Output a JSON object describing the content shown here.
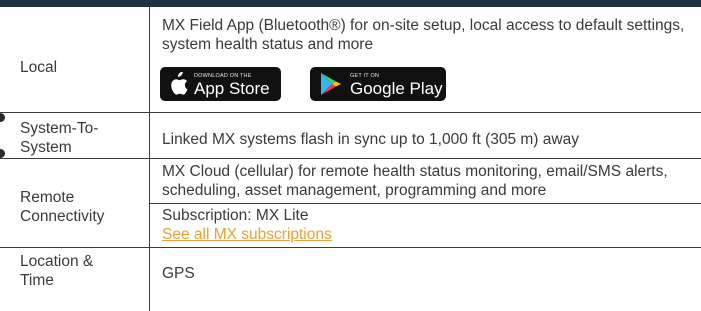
{
  "rows": {
    "local": {
      "label": "Local",
      "description": "MX Field App (Bluetooth®) for on-site setup, local access to default settings, system health status and more",
      "app_store": {
        "small": "Download on the",
        "big": "App Store"
      },
      "google_play": {
        "small": "GET IT ON",
        "big": "Google Play"
      }
    },
    "system_to_system": {
      "label": "System-To-System",
      "description": "Linked MX systems flash in sync up to 1,000 ft (305 m) away"
    },
    "remote": {
      "label": "Remote Connectivity",
      "description": "MX Cloud (cellular) for remote health status monitoring, email/SMS alerts, scheduling, asset management, programming and more",
      "subscription": "Subscription: MX Lite",
      "subscriptions_link": "See all MX subscriptions"
    },
    "location": {
      "label": "Location & Time",
      "description": "GPS"
    }
  },
  "colors": {
    "header_bar": "#1f3147",
    "link": "#e8a03a",
    "text": "#3a3a3a"
  },
  "icons": [
    "apple-icon",
    "google-play-icon"
  ]
}
